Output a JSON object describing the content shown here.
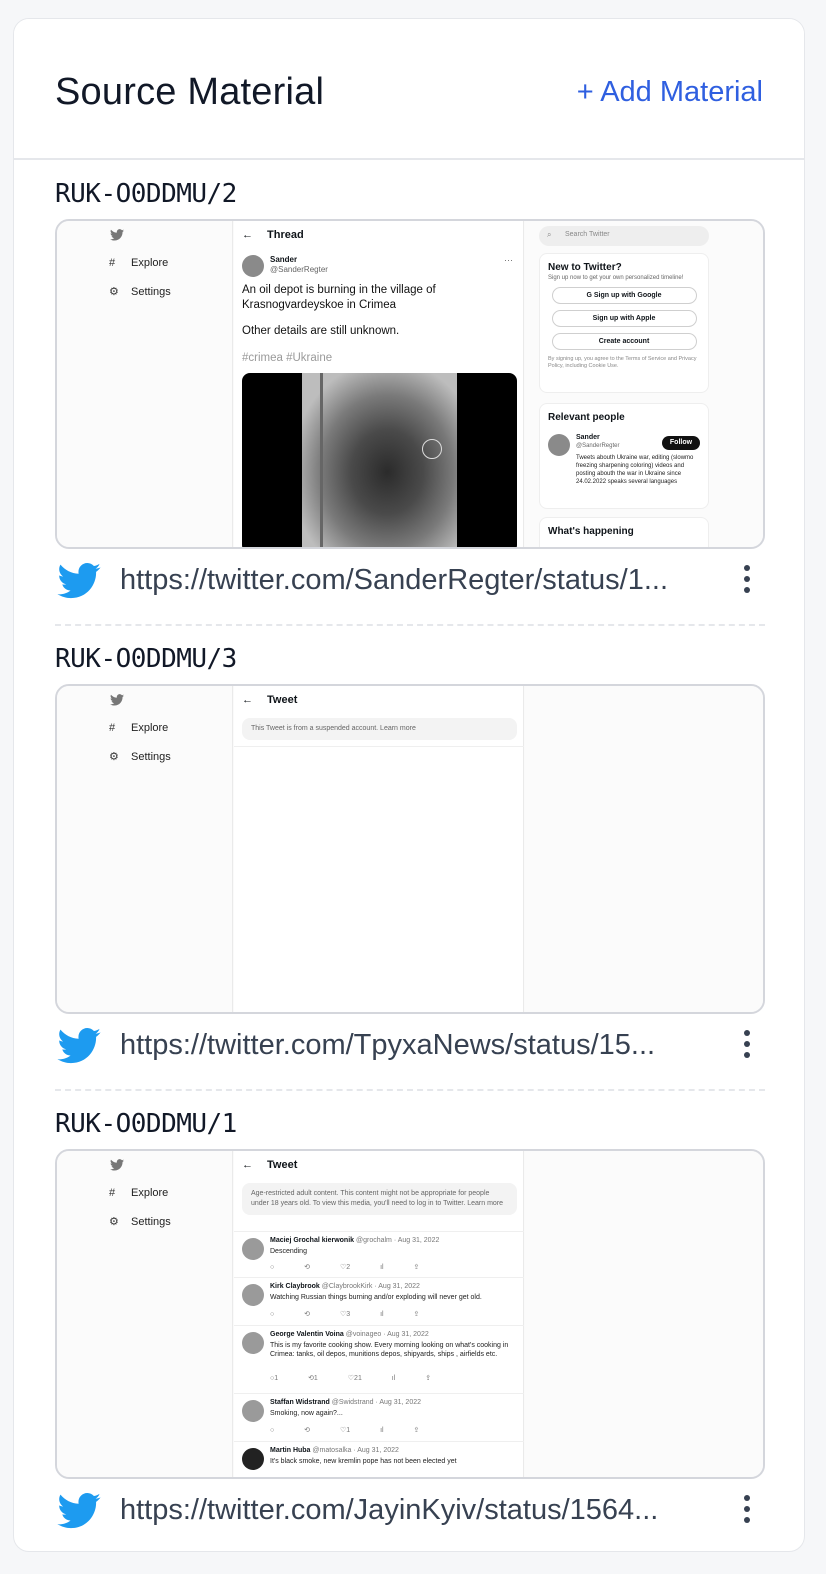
{
  "panel": {
    "title": "Source Material",
    "add_label": "+ Add Material"
  },
  "items": [
    {
      "id": "RUK-O0DDMU/2",
      "url": "https://twitter.com/SanderRegter/status/1...",
      "shot": {
        "nav_explore": "Explore",
        "nav_settings": "Settings",
        "header": "Thread",
        "author_name": "Sander",
        "author_handle": "@SanderRegter",
        "tweet_line1": "An oil depot is burning in the village of",
        "tweet_line2": "Krasnogvardeyskoe in Crimea",
        "tweet_line3": "Other details are still unknown.",
        "tags": "#crimea #Ukraine",
        "search_placeholder": "Search Twitter",
        "new_title": "New to Twitter?",
        "new_sub": "Sign up now to get your own personalized timeline!",
        "google": "Sign up with Google",
        "apple": "Sign up with Apple",
        "create": "Create account",
        "terms": "By signing up, you agree to the Terms of Service and Privacy Policy, including Cookie Use.",
        "relevant_title": "Relevant people",
        "rel_name": "Sander",
        "rel_handle": "@SanderRegter",
        "follow": "Follow",
        "rel_bio": "Tweets abouth Ukraine war, editing (slowmo freezing sharpening coloring) videos and posting abouth the war in Ukraine since 24.02.2022 speaks several languages",
        "happening": "What's happening"
      }
    },
    {
      "id": "RUK-O0DDMU/3",
      "url": "https://twitter.com/TpyxaNews/status/15...",
      "shot": {
        "nav_explore": "Explore",
        "nav_settings": "Settings",
        "header": "Tweet",
        "notice": "This Tweet is from a suspended account. Learn more"
      }
    },
    {
      "id": "RUK-O0DDMU/1",
      "url": "https://twitter.com/JayinKyiv/status/1564...",
      "shot": {
        "nav_explore": "Explore",
        "nav_settings": "Settings",
        "header": "Tweet",
        "notice": "Age-restricted adult content. This content might not be appropriate for people under 18 years old. To view this media, you'll need to log in to Twitter. Learn more",
        "replies": [
          {
            "name": "Maciej Grochal kierwonik",
            "meta": "@grochalm · Aug 31, 2022",
            "text": "Descending",
            "acts": "○ ⟲ ♡2 ıl ⇪"
          },
          {
            "name": "Kirk Claybrook",
            "meta": "@ClaybrookKirk · Aug 31, 2022",
            "text": "Watching Russian things burning and/or exploding will never get old.",
            "acts": "○ ⟲ ♡3 ıl ⇪"
          },
          {
            "name": "George Valentin Voina",
            "meta": "@voinageo · Aug 31, 2022",
            "text": "This is my favorite cooking show. Every morning looking on what's cooking in Crimea: tanks, oil depos, munitions depos, shipyards, ships , airfields etc.",
            "acts": "○1 ⟲1 ♡21 ıl ⇪"
          },
          {
            "name": "Staffan Widstrand",
            "meta": "@Swidstrand · Aug 31, 2022",
            "text": "Smoking, now again?...",
            "acts": "○ ⟲ ♡1 ıl ⇪"
          },
          {
            "name": "Martin Huba",
            "meta": "@matosalka · Aug 31, 2022",
            "text": "It's black smoke, new kremlin pope has not been elected yet",
            "acts": ""
          }
        ]
      }
    }
  ],
  "colors": {
    "accent": "#2f5fe0",
    "twitter_blue": "#1d9bf0"
  },
  "icons": {
    "twitter": "twitter-bird-icon",
    "more": "kebab-menu-icon"
  }
}
